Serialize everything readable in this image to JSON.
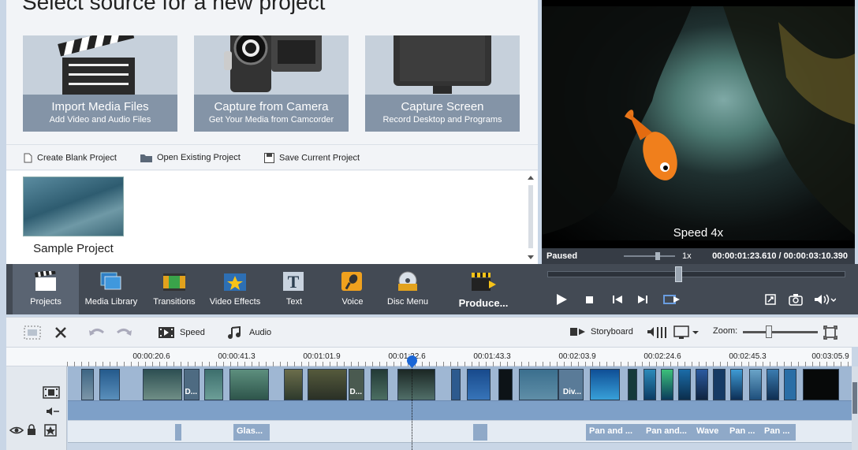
{
  "source_panel": {
    "heading": "Select source for a new project",
    "cards": [
      {
        "title": "Import Media Files",
        "subtitle": "Add Video and Audio Files",
        "icon": "clapperboard-icon"
      },
      {
        "title": "Capture from Camera",
        "subtitle": "Get Your Media from Camcorder",
        "icon": "camcorder-icon"
      },
      {
        "title": "Capture Screen",
        "subtitle": "Record Desktop and Programs",
        "icon": "monitor-icon"
      }
    ],
    "actions": [
      {
        "label": "Create Blank Project",
        "icon": "blank-document-icon"
      },
      {
        "label": "Open Existing Project",
        "icon": "folder-icon"
      },
      {
        "label": "Save Current Project",
        "icon": "floppy-disk-icon"
      }
    ],
    "projects": [
      {
        "name": "Sample Project"
      }
    ]
  },
  "preview": {
    "overlay_text": "Speed 4x",
    "status": "Paused",
    "speed_value": "1x",
    "current_time": "00:00:01:23.610",
    "total_time": "00:00:03:10.390",
    "time_separator": "/",
    "seek_fraction": 0.44
  },
  "ribbon": {
    "items": [
      {
        "label": "Projects",
        "icon": "projects-clapper-icon",
        "active": true
      },
      {
        "label": "Media Library",
        "icon": "film-stack-icon"
      },
      {
        "label": "Transitions",
        "icon": "transitions-icon"
      },
      {
        "label": "Video Effects",
        "icon": "star-effects-icon"
      },
      {
        "label": "Text",
        "icon": "text-T-icon"
      },
      {
        "label": "Voice",
        "icon": "microphone-icon"
      },
      {
        "label": "Disc Menu",
        "icon": "disc-icon"
      },
      {
        "label": "Produce...",
        "icon": "produce-clapper-icon"
      }
    ]
  },
  "timeline_toolbar": {
    "speed_label": "Speed",
    "audio_label": "Audio",
    "storyboard_label": "Storyboard",
    "zoom_label": "Zoom:"
  },
  "ruler": {
    "ticks": [
      "00:00:20.6",
      "00:00:41.3",
      "00:01:01.9",
      "00:01:22.6",
      "00:01:43.3",
      "00:02:03.9",
      "00:02:24.6",
      "00:02:45.3",
      "00:03:05.9"
    ]
  },
  "clip_labels": [
    "D...",
    "D...",
    "Div..."
  ],
  "fx_labels": [
    "Glas...",
    "Pan and ...",
    "Pan and...",
    "Wave",
    "Pan ...",
    "Pan ..."
  ],
  "colors": {
    "ribbon_bg": "#434a54",
    "card_label_bg": "#8494a7",
    "playhead": "#1a66d6",
    "video_track": "#9fb7d3"
  }
}
